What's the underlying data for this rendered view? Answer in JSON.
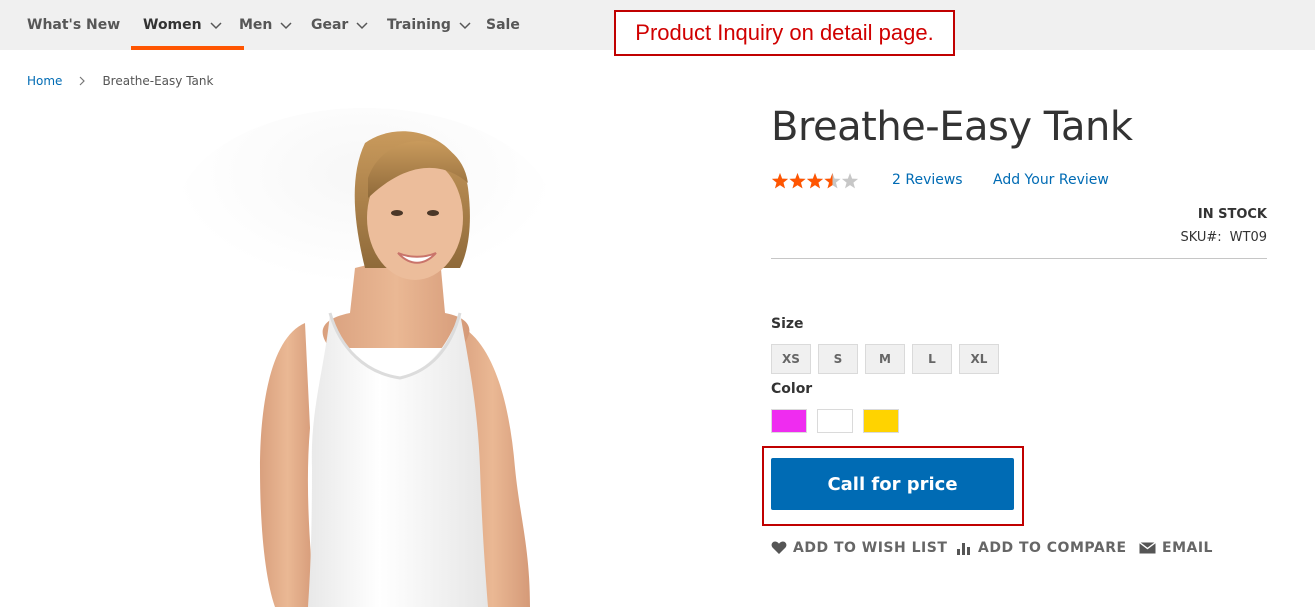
{
  "nav": {
    "items": [
      {
        "label": "What's New",
        "has_chevron": false
      },
      {
        "label": "Women",
        "has_chevron": true,
        "active": true
      },
      {
        "label": "Men",
        "has_chevron": true
      },
      {
        "label": "Gear",
        "has_chevron": true
      },
      {
        "label": "Training",
        "has_chevron": true
      },
      {
        "label": "Sale",
        "has_chevron": false
      }
    ],
    "active_color": "#ff5501"
  },
  "annotation_top": "Product Inquiry on detail page.",
  "breadcrumb": {
    "home": "Home",
    "current": "Breathe-Easy Tank"
  },
  "product": {
    "title": "Breathe-Easy Tank",
    "rating_stars": 3.5,
    "rating_max": 5,
    "reviews_label": "2  Reviews",
    "add_review_label": "Add Your Review",
    "stock": "IN STOCK",
    "sku_label": "SKU#:",
    "sku_value": "WT09"
  },
  "options": {
    "size_label": "Size",
    "sizes": [
      "XS",
      "S",
      "M",
      "L",
      "XL"
    ],
    "color_label": "Color",
    "colors": [
      "#ef2cf0",
      "#ffffff",
      "#ffd300"
    ]
  },
  "call_button_label": "Call for price",
  "actions": {
    "wish": "ADD TO WISH LIST",
    "compare": "ADD TO COMPARE",
    "email": "EMAIL"
  },
  "colors": {
    "link": "#006bb4",
    "annotation": "#c00000",
    "star": "#ff5501"
  }
}
